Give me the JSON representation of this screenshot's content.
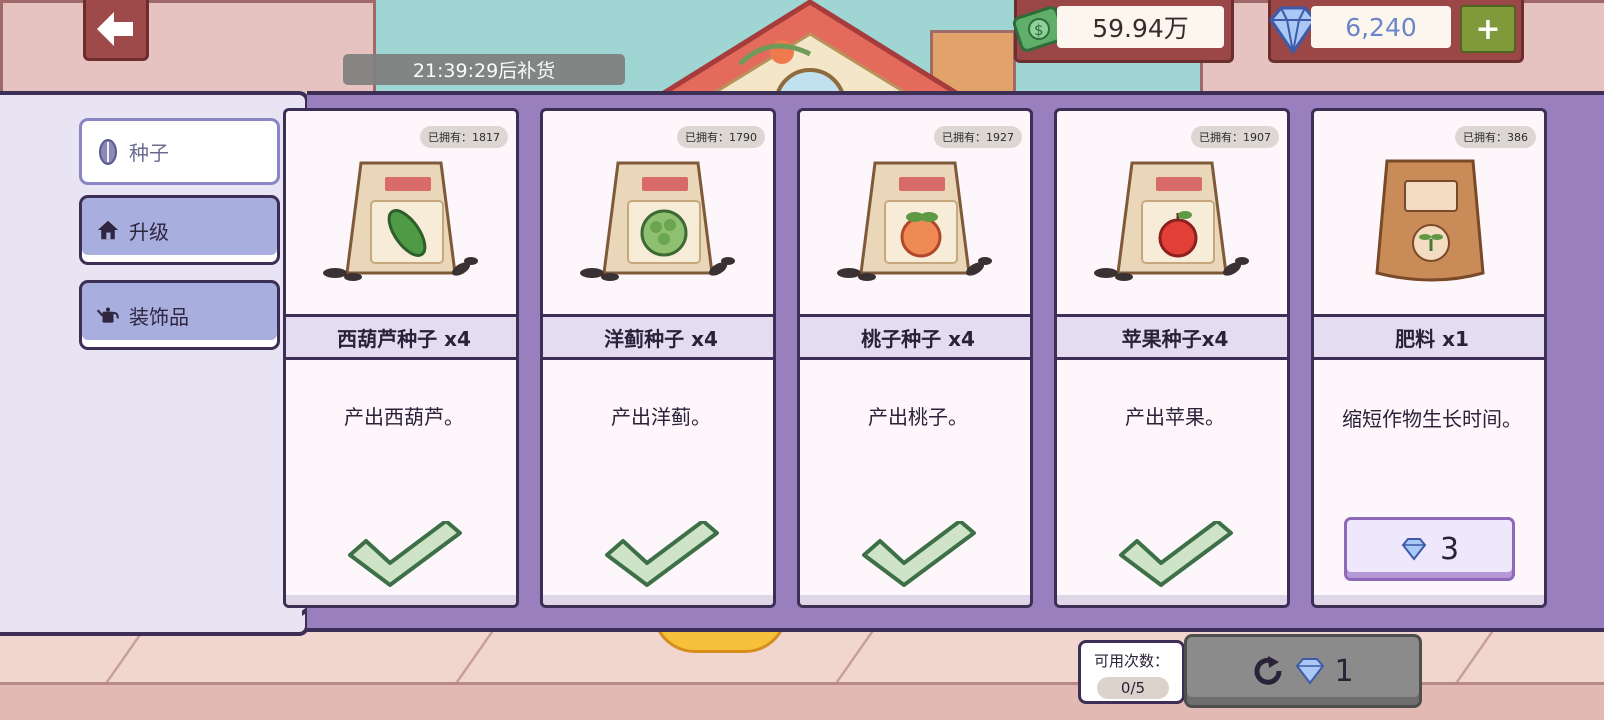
{
  "header": {
    "restock_timer": "21:39:29后补货",
    "money": "59.94万",
    "gems": "6,240",
    "add_label": "+"
  },
  "categories": [
    {
      "label": "种子",
      "active": true,
      "icon": "seed-icon"
    },
    {
      "label": "升级",
      "active": false,
      "icon": "house-icon"
    },
    {
      "label": "装饰品",
      "active": false,
      "icon": "watering-can-icon"
    }
  ],
  "items": [
    {
      "owned": "已拥有：1817",
      "name": "西葫芦种子 x4",
      "desc": "产出西葫芦。",
      "status": "purchased",
      "produce": "zucchini"
    },
    {
      "owned": "已拥有：1790",
      "name": "洋蓟种子 x4",
      "desc": "产出洋蓟。",
      "status": "purchased",
      "produce": "artichoke"
    },
    {
      "owned": "已拥有：1927",
      "name": "桃子种子 x4",
      "desc": "产出桃子。",
      "status": "purchased",
      "produce": "peach"
    },
    {
      "owned": "已拥有：1907",
      "name": "苹果种子x4",
      "desc": "产出苹果。",
      "status": "purchased",
      "produce": "apple"
    },
    {
      "owned": "已拥有：386",
      "name": "肥料 x1",
      "desc": "缩短作物生长时间。",
      "status": "buy",
      "price": "3"
    }
  ],
  "refresh": {
    "uses_label": "可用次数：",
    "uses_value": "0/5",
    "cost": "1"
  },
  "colors": {
    "panel_border": "#3d2e55",
    "cards_bg": "#9a7fbe",
    "check_fill": "#cfe3c6",
    "check_stroke": "#3e7048"
  }
}
